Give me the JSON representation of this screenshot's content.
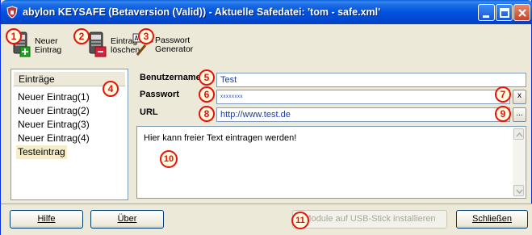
{
  "window": {
    "title": "abylon KEYSAFE (Betaversion (Valid)) - Aktuelle Safedatei: 'tom - safe.xml'"
  },
  "toolbar": {
    "new_entry": {
      "line1": "Neuer",
      "line2": "Eintrag",
      "icon": "new-entry-icon"
    },
    "delete_entry": {
      "line1": "Eintrag",
      "line2": "löschen",
      "icon": "delete-entry-icon"
    },
    "password_generator": {
      "line1": "Passwort",
      "line2": "Generator",
      "icon": "password-generator-icon",
      "icon_text": "A14;"
    }
  },
  "entries": {
    "header": "Einträge",
    "items": [
      "Neuer Eintrag(1)",
      "Neuer Eintrag(2)",
      "Neuer Eintrag(3)",
      "Neuer Eintrag(4)",
      "Testeintrag"
    ],
    "selected_index": 4
  },
  "form": {
    "username_label": "Benutzername",
    "username_value": "Test",
    "password_label": "Passwort",
    "password_value": "xxxxxxxx",
    "password_button": "x",
    "url_label": "URL",
    "url_value": "http://www.test.de",
    "url_button": "...",
    "notes": "Hier kann freier Text eintragen werden!"
  },
  "buttons": {
    "help": "Hilfe",
    "about": "Über",
    "install_usb": "Module auf USB-Stick installieren",
    "close": "Schließen"
  },
  "badges": [
    "1",
    "2",
    "3",
    "4",
    "5",
    "6",
    "7",
    "8",
    "9",
    "10",
    "11"
  ],
  "colors": {
    "annotation": "#e8120a",
    "titlebar": "#0053e0",
    "selection": "#f5edc9"
  }
}
